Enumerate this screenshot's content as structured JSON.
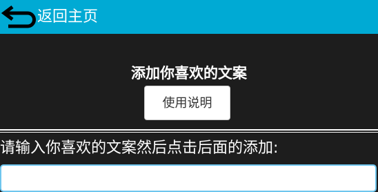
{
  "header": {
    "back_label": "返回主页",
    "back_icon": "back-arrow-icon",
    "background_color": "#00aad4"
  },
  "main": {
    "title": "添加你喜欢的文案",
    "help_button_label": "使用说明",
    "instruction": "请输入你喜欢的文案然后点击后面的添加:",
    "input_value": "",
    "input_placeholder": ""
  },
  "colors": {
    "page_background": "#1d1d1d",
    "input_border": "#6ec6ee"
  }
}
